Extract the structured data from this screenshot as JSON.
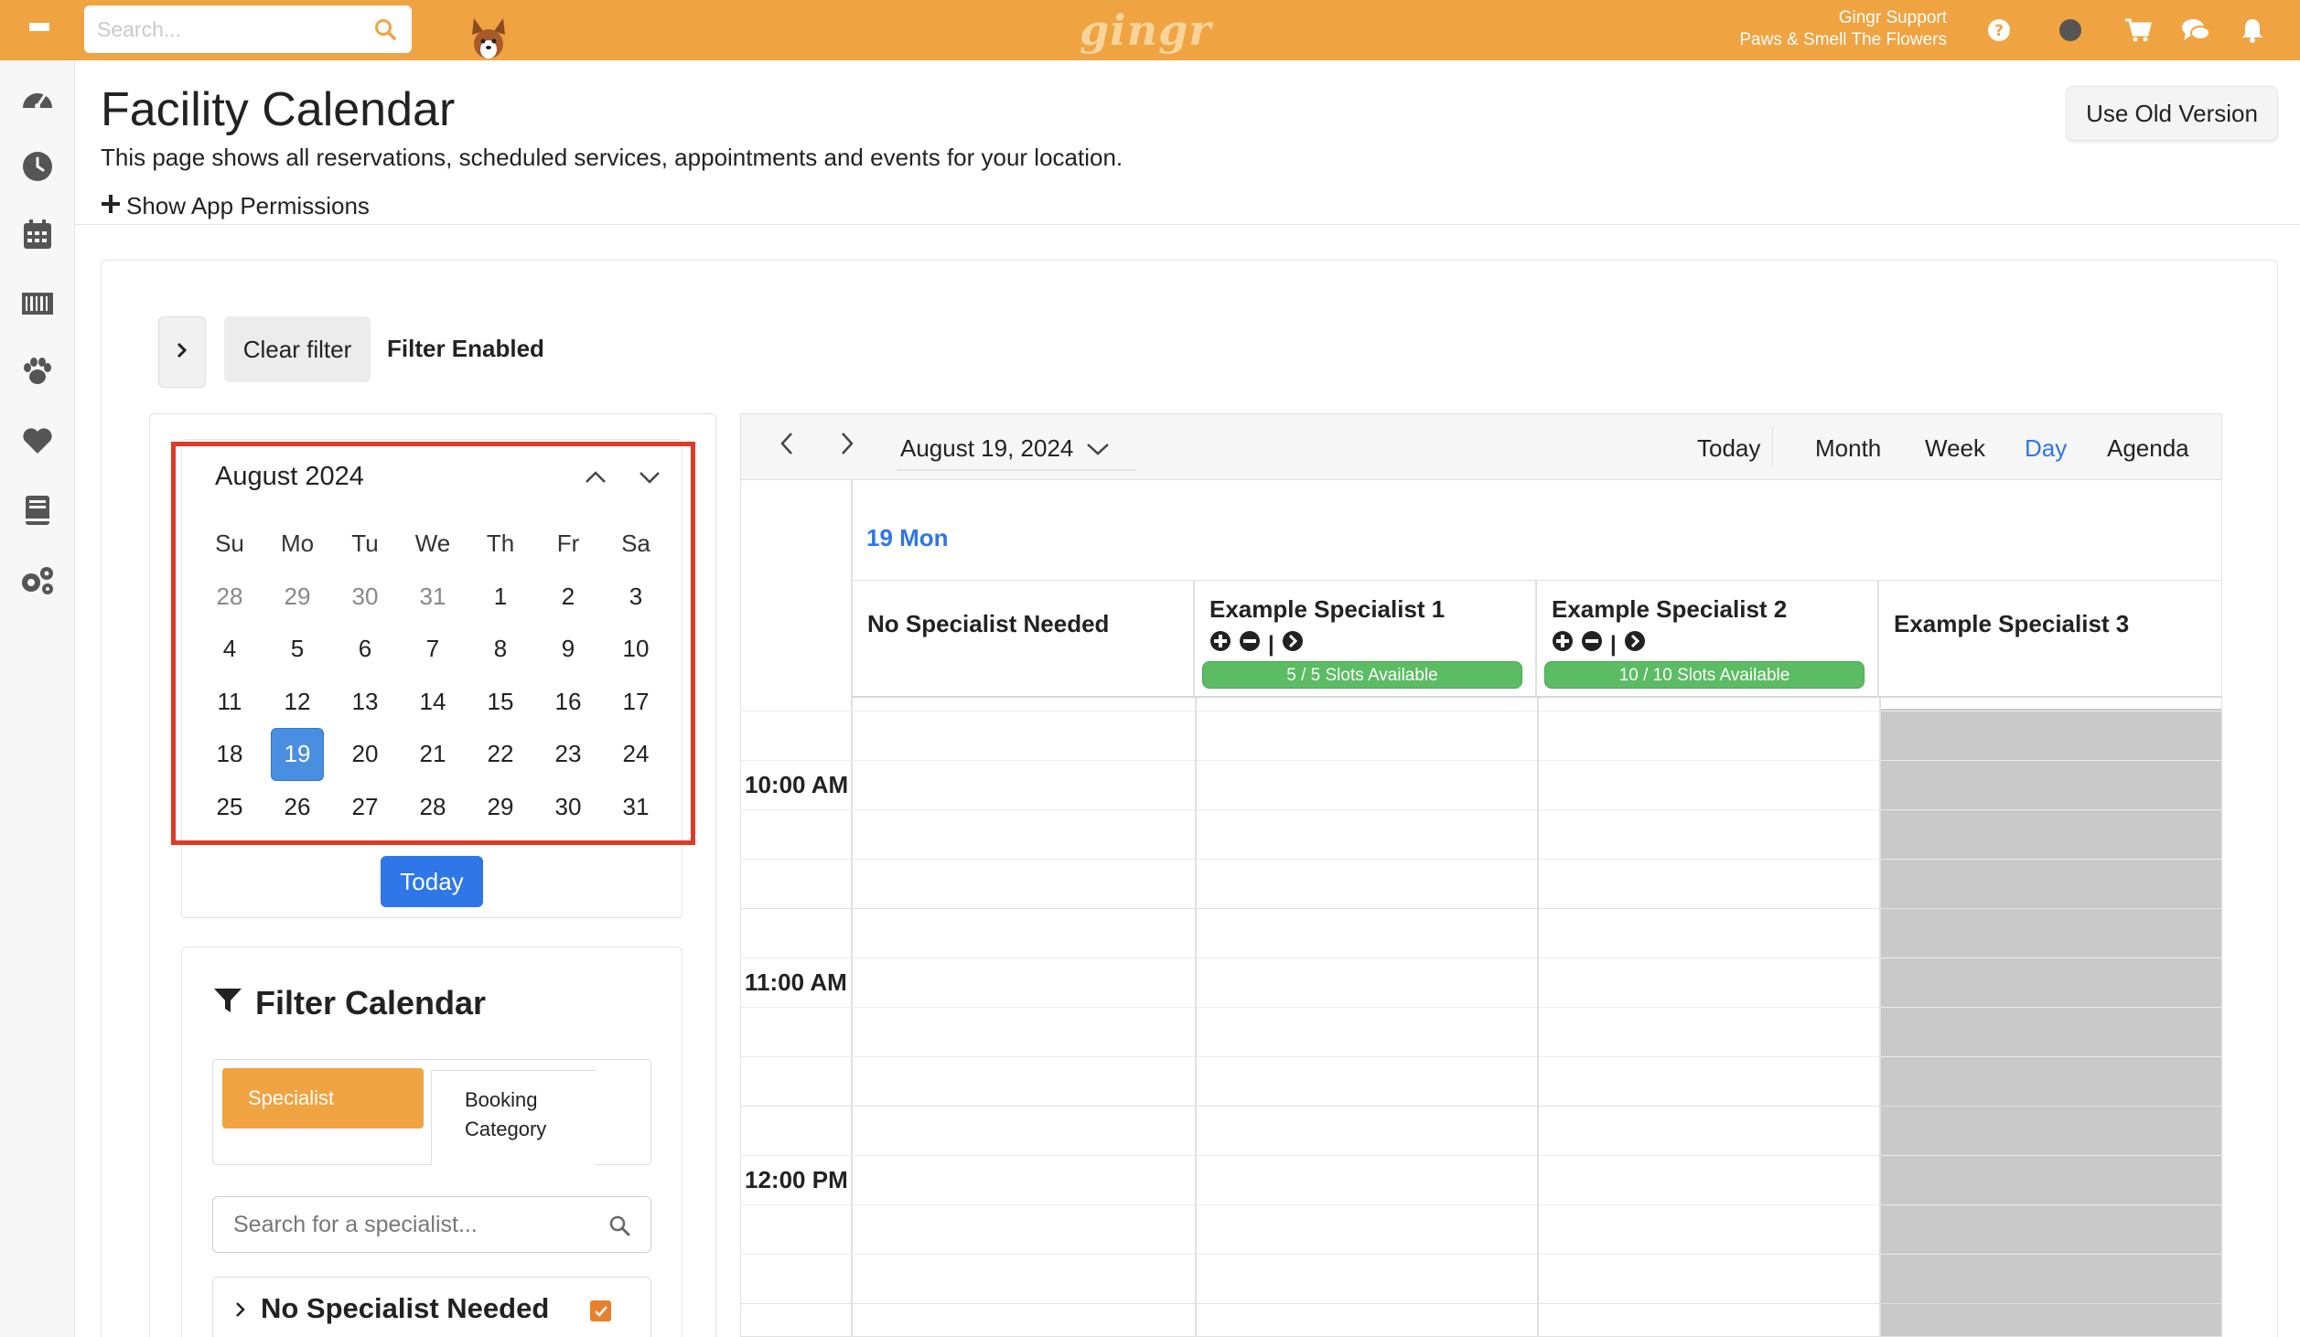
{
  "topbar": {
    "search_placeholder": "Search...",
    "logo": "gingr",
    "user_name": "Gingr Support",
    "location": "Paws & Smell The Flowers"
  },
  "header": {
    "title": "Facility Calendar",
    "description": "This page shows all reservations, scheduled services, appointments and events for your location.",
    "show_permissions": "Show App Permissions",
    "old_version_button": "Use Old Version"
  },
  "filter_bar": {
    "clear_filter": "Clear filter",
    "status": "Filter Enabled"
  },
  "mini_calendar": {
    "month_label": "August 2024",
    "weekdays": [
      "Su",
      "Mo",
      "Tu",
      "We",
      "Th",
      "Fr",
      "Sa"
    ],
    "weeks": [
      [
        "28",
        "29",
        "30",
        "31",
        "1",
        "2",
        "3"
      ],
      [
        "4",
        "5",
        "6",
        "7",
        "8",
        "9",
        "10"
      ],
      [
        "11",
        "12",
        "13",
        "14",
        "15",
        "16",
        "17"
      ],
      [
        "18",
        "19",
        "20",
        "21",
        "22",
        "23",
        "24"
      ],
      [
        "25",
        "26",
        "27",
        "28",
        "29",
        "30",
        "31"
      ]
    ],
    "selected_day": "19",
    "today_button": "Today"
  },
  "filter_calendar": {
    "title": "Filter Calendar",
    "tabs": [
      "Specialist",
      "Booking Category"
    ],
    "active_tab": "Specialist",
    "search_placeholder": "Search for a specialist...",
    "items": [
      {
        "label": "No Specialist Needed",
        "checked": true
      }
    ]
  },
  "calendar": {
    "current_date": "August 19, 2024",
    "views": [
      "Today",
      "Month",
      "Week",
      "Day",
      "Agenda"
    ],
    "active_view": "Day",
    "day_header": "19 Mon",
    "resources": [
      {
        "name": "No Specialist Needed",
        "slots": ""
      },
      {
        "name": "Example Specialist 1",
        "slots": "5 / 5 Slots Available"
      },
      {
        "name": "Example Specialist 2",
        "slots": "10 / 10 Slots Available"
      },
      {
        "name": "Example Specialist 3",
        "slots": ""
      }
    ],
    "time_labels": [
      "10:00 AM",
      "11:00 AM",
      "12:00 PM"
    ]
  },
  "colors": {
    "brand": "#f0a341",
    "accent_blue": "#2f76e8",
    "slot_green": "#5bbc63",
    "highlight_red": "#e03a27",
    "unavailable_grey": "#c9c9c9"
  },
  "icons": [
    "menu-icon",
    "search-icon",
    "dog-mascot-icon",
    "help-icon",
    "status-dot-icon",
    "cart-icon",
    "chat-icon",
    "bell-icon",
    "dashboard-icon",
    "clock-icon",
    "calendar-icon",
    "barcode-icon",
    "paw-icon",
    "heart-icon",
    "book-icon",
    "settings-icon",
    "plus-icon",
    "chevron-right-icon",
    "filter-icon"
  ]
}
